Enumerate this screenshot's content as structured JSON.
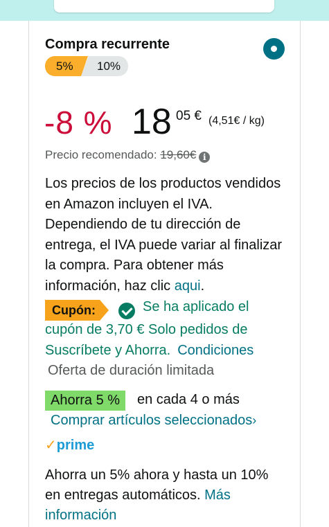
{
  "header": {
    "title": "Compra recurrente"
  },
  "tiers": [
    "5%",
    "10%"
  ],
  "price": {
    "discount": "-8 %",
    "whole": "18",
    "fraction": "05 €",
    "unit": "(4,51€ / kg)",
    "recommended_label": "Precio recomendado:",
    "recommended_value": "19,60€",
    "info_glyph": "i"
  },
  "vat": {
    "text": "Los precios de los productos vendidos en Amazon incluyen el IVA. Dependiendo de tu dirección de entrega, el IVA puede variar al finalizar la compra. Para obtener más información, haz clic ",
    "link": "aqui",
    "end": "."
  },
  "coupon": {
    "badge": "Cupón:",
    "line1": "Se ha aplicado el",
    "line2": "cupón de 3,70 € Solo pedidos de",
    "line3": "Suscríbete y Ahorra.",
    "conditions": "Condiciones"
  },
  "limited_offer": "Oferta de duración limitada",
  "savings": {
    "badge": "Ahorra 5 %",
    "text": "en cada 4 o más",
    "link": "Comprar artículos seleccionados",
    "chevron": "›"
  },
  "prime": {
    "tick": "✓",
    "label": "prime"
  },
  "bottom": {
    "text": "Ahorra un 5% ahora y hasta un 10% en entregas automáticos. ",
    "link": "Más información"
  },
  "colors": {
    "accent": "#007185",
    "discount": "#cc0c39",
    "coupon_green": "#067d62",
    "coupon_badge": "#f7a21b",
    "save_badge": "#7fda69",
    "prime_blue": "#1d9bd7"
  },
  "icons": {
    "radio": "radio-selected-icon",
    "info": "info-icon",
    "check": "check-circle-icon",
    "chevron": "chevron-right-icon",
    "prime_check": "prime-check-icon"
  }
}
